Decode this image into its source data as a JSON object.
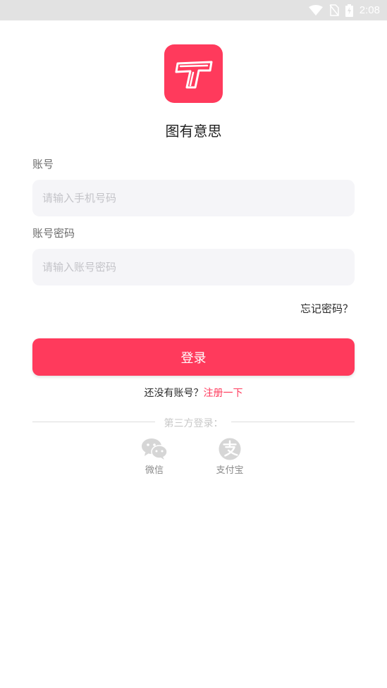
{
  "status_bar": {
    "time": "2:08"
  },
  "app": {
    "name": "图有意思",
    "accent": "#ff3a5c"
  },
  "form": {
    "account_label": "账号",
    "account_placeholder": "请输入手机号码",
    "account_value": "",
    "password_label": "账号密码",
    "password_placeholder": "请输入账号密码",
    "password_value": "",
    "forgot_label": "忘记密码？",
    "login_label": "登录",
    "no_account_text": "还没有账号？",
    "register_label": "注册一下"
  },
  "third_party": {
    "title": "第三方登录：",
    "wechat_label": "微信",
    "alipay_label": "支付宝"
  }
}
